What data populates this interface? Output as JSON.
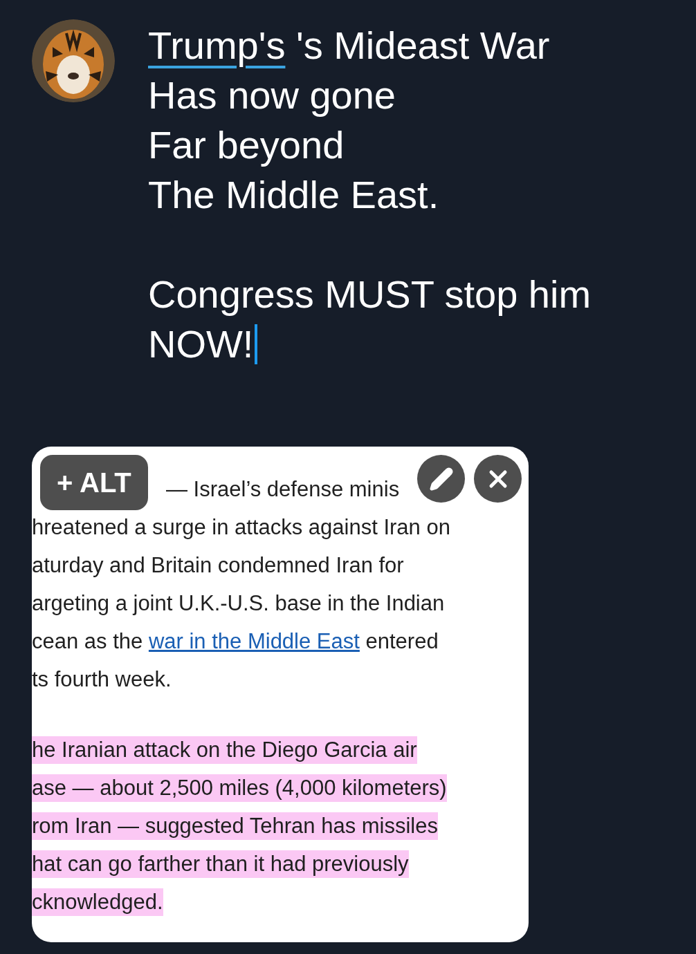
{
  "post": {
    "paragraphs": [
      {
        "lines": [
          {
            "segments": [
              {
                "text": "Trump's",
                "misspelled": true
              },
              {
                "text": " 's Mideast War",
                "misspelled": false
              }
            ]
          },
          {
            "segments": [
              {
                "text": "Has now gone",
                "misspelled": false
              }
            ]
          },
          {
            "segments": [
              {
                "text": "Far beyond",
                "misspelled": false
              }
            ]
          },
          {
            "segments": [
              {
                "text": "The Middle East.",
                "misspelled": false
              }
            ]
          }
        ]
      },
      {
        "lines": [
          {
            "segments": [
              {
                "text": "Congress MUST stop him",
                "misspelled": false
              }
            ]
          },
          {
            "segments": [
              {
                "text": "NOW!",
                "misspelled": false
              }
            ],
            "cursor": true
          }
        ]
      }
    ]
  },
  "attachment": {
    "alt_button": "+ ALT",
    "paragraphs": [
      {
        "highlighted": false,
        "lines": [
          [
            {
              "text": "— Israel’s defense minis",
              "link": false
            }
          ],
          [
            {
              "text": "hreatened a surge in attacks against Iran on",
              "link": false
            }
          ],
          [
            {
              "text": "aturday and Britain condemned Iran for",
              "link": false
            }
          ],
          [
            {
              "text": "argeting a joint U.K.-U.S. base in the Indian",
              "link": false
            }
          ],
          [
            {
              "text": "cean as the ",
              "link": false
            },
            {
              "text": "war in the Middle East",
              "link": true
            },
            {
              "text": " entered",
              "link": false
            }
          ],
          [
            {
              "text": "ts fourth week.",
              "link": false
            }
          ]
        ]
      },
      {
        "highlighted": true,
        "lines": [
          [
            {
              "text": "he Iranian attack on the Diego Garcia air",
              "link": false
            }
          ],
          [
            {
              "text": "ase — about 2,500 miles (4,000 kilometers)",
              "link": false
            }
          ],
          [
            {
              "text": "rom Iran — suggested Tehran has missiles",
              "link": false
            }
          ],
          [
            {
              "text": "hat can go farther than it had previously",
              "link": false
            }
          ],
          [
            {
              "text": "cknowledged.",
              "link": false
            }
          ]
        ]
      }
    ]
  }
}
